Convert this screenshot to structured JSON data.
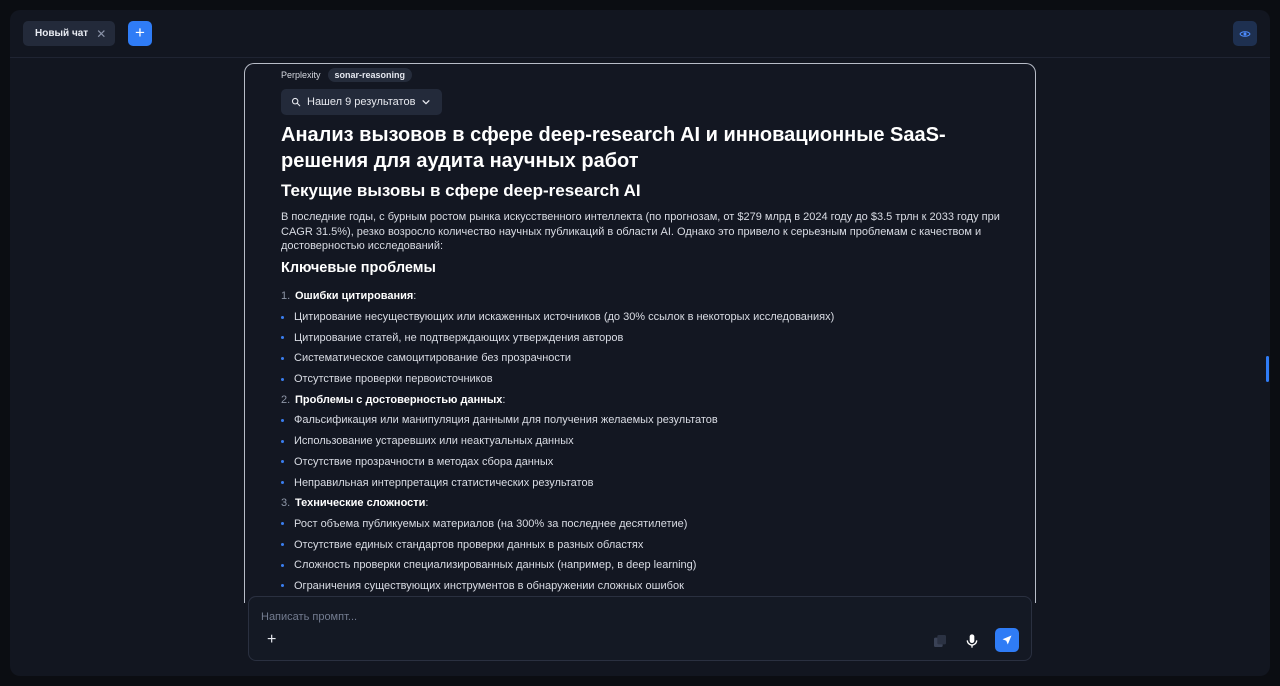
{
  "tabs": [
    {
      "label": "Новый чат"
    }
  ],
  "answer": {
    "provider": "Perplexity",
    "model": "sonar-reasoning",
    "results_label": "Нашел 9 результатов",
    "title": "Анализ вызовов в сфере deep-research AI и инновационные SaaS-решения для аудита научных работ",
    "section_title": "Текущие вызовы в сфере deep-research AI",
    "intro": "В последние годы, с бурным ростом рынка искусственного интеллекта (по прогнозам, от $279 млрд в 2024 году до $3.5 трлн к 2033 году при CAGR 31.5%), резко возросло количество научных публикаций в области AI. Однако это привело к серьезным проблемам с качеством и достоверностью исследований:",
    "subsection_title": "Ключевые проблемы",
    "problems": [
      {
        "number": "1.",
        "title": "Ошибки цитирования",
        "items": [
          "Цитирование несуществующих или искаженных источников (до 30% ссылок в некоторых исследованиях)",
          "Цитирование статей, не подтверждающих утверждения авторов",
          "Систематическое самоцитирование без прозрачности",
          "Отсутствие проверки первоисточников"
        ]
      },
      {
        "number": "2.",
        "title": "Проблемы с достоверностью данных",
        "items": [
          "Фальсификация или манипуляция данными для получения желаемых результатов",
          "Использование устаревших или неактуальных данных",
          "Отсутствие прозрачности в методах сбора данных",
          "Неправильная интерпретация статистических результатов"
        ]
      },
      {
        "number": "3.",
        "title": "Технические сложности",
        "items": [
          "Рост объема публикуемых материалов (на 300% за последнее десятилетие)",
          "Отсутствие единых стандартов проверки данных в разных областях",
          "Сложность проверки специализированных данных (например, в deep learning)",
          "Ограничения существующих инструментов в обнаружении сложных ошибок"
        ]
      }
    ]
  },
  "composer": {
    "placeholder": "Написать промпт...",
    "value": ""
  },
  "icons": {
    "tab_close": "close-icon",
    "new_tab": "plus-icon",
    "visibility": "eye-icon",
    "search": "search-icon",
    "expand": "chevron-down-icon",
    "attach": "plus-icon",
    "files": "file-stack-icon",
    "voice": "microphone-icon",
    "send": "send-icon"
  },
  "colors": {
    "accent": "#2f7cf6",
    "background": "#121620",
    "card_border": "#b8bdc8"
  }
}
